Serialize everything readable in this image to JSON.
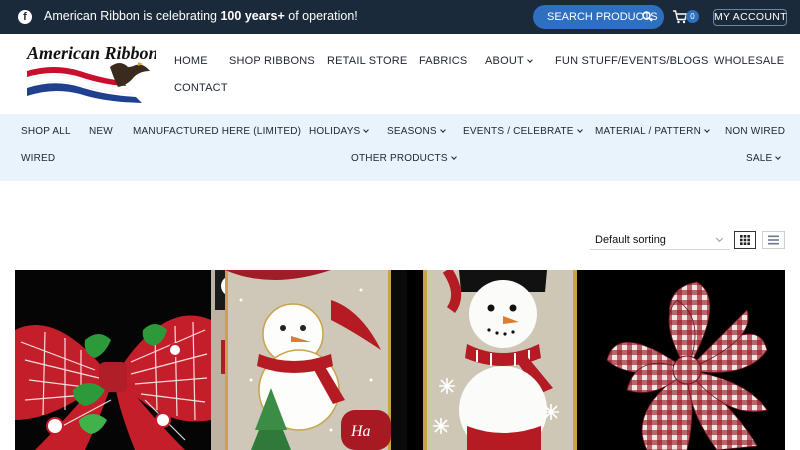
{
  "topbar": {
    "facebook_icon": "facebook-icon",
    "announcement_prefix": "American Ribbon is celebrating ",
    "announcement_bold": "100 years+",
    "announcement_suffix": " of operation!",
    "search_label": "SEARCH PRODUCTS",
    "cart_count": "0",
    "account_label": "MY ACCOUNT"
  },
  "header": {
    "logo_text": "American Ribbon",
    "nav": [
      "HOME",
      "SHOP RIBBONS",
      "RETAIL STORE",
      "FABRICS",
      "ABOUT",
      "FUN STUFF/EVENTS/BLOGS",
      "WHOLESALE",
      "CONTACT"
    ]
  },
  "categories": [
    "SHOP ALL",
    "NEW",
    "MANUFACTURED HERE (LIMITED)",
    "HOLIDAYS",
    "SEASONS",
    "EVENTS / CELEBRATE",
    "MATERIAL / PATTERN",
    "NON WIRED",
    "WIRED",
    "OTHER PRODUCTS",
    "SALE"
  ],
  "sorting": {
    "selected": "Default sorting"
  },
  "products": [
    {
      "name": "christmas-grinch-bow"
    },
    {
      "name": "snowman-linen-ribbon"
    },
    {
      "name": "snowman-scarf-ribbon"
    },
    {
      "name": "red-gingham-bow"
    }
  ],
  "colors": {
    "topbar": "#1b2a3a",
    "accent": "#2f6fc0",
    "category_bar": "#e9f3fb"
  }
}
